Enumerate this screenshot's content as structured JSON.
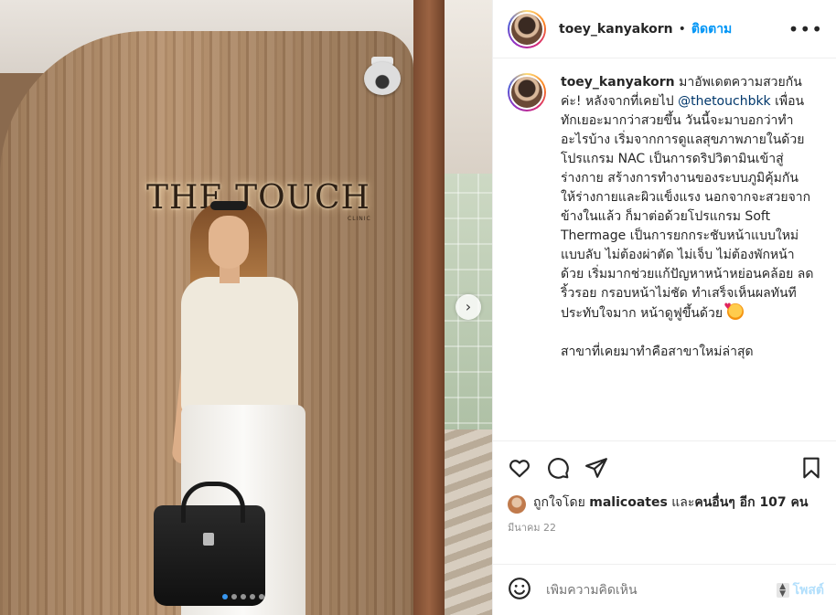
{
  "post": {
    "username": "toey_kanyakorn",
    "follow_label": "ติดตาม",
    "header_separator": "•",
    "more_label": "•••",
    "photo": {
      "brand_text": "THE TOUCH",
      "brand_sub": "CLINIC",
      "carousel_dots": 5,
      "active_dot": 0,
      "next_label": "›"
    },
    "caption": {
      "username": "toey_kanyakorn",
      "text_1": " มาอัพเดตความสวยกันค่ะ! หลังจากที่เคยไป ",
      "mention": "@thetouchbkk",
      "text_2": " เพื่อนทักเยอะมากว่าสวยขึ้น วันนี้จะมาบอกว่าทำอะไรบ้าง เริ่มจากการดูแลสุขภาพภายในด้วยโปรแกรม NAC เป็นการดริปวิตามินเข้าสู่ร่างกาย สร้างการทำงานของระบบภูมิคุ้มกัน ให้ร่างกายและผิวแข็งแรง นอกจากจะสวยจากข้างในแล้ว ก็มาต่อด้วยโปรแกรม Soft Thermage เป็นการยกกระชับหน้าแบบใหม่ แบบลับ ไม่ต้องผ่าตัด ไม่เจ็บ ไม่ต้องพักหน้าด้วย เริ่มมากช่วยแก้ปัญหาหน้าหย่อนคล้อย ลดริ้วรอย กรอบหน้าไม่ชัด ทำเสร็จเห็นผลทันที ประทับใจมาก หน้าดูฟูขึ้นด้วย ",
      "emoji": "smiling-face-with-hearts",
      "text_3": "สาขาที่เคยมาทำคือสาขาใหม่ล่าสุด"
    },
    "likes": {
      "prefix": "ถูกใจโดย ",
      "liker": "malicoates",
      "middle": " และ",
      "others": "คนอื่นๆ อีก 107 คน"
    },
    "date": "มีนาคม 22",
    "comment": {
      "placeholder": "เพิ่มความคิดเห็น",
      "post_label": "โพสต์"
    }
  },
  "colors": {
    "follow_blue": "#0095f6",
    "mention_blue": "#00376b",
    "post_disabled": "#b2dffc",
    "text": "#262626",
    "muted": "#8e8e8e"
  }
}
